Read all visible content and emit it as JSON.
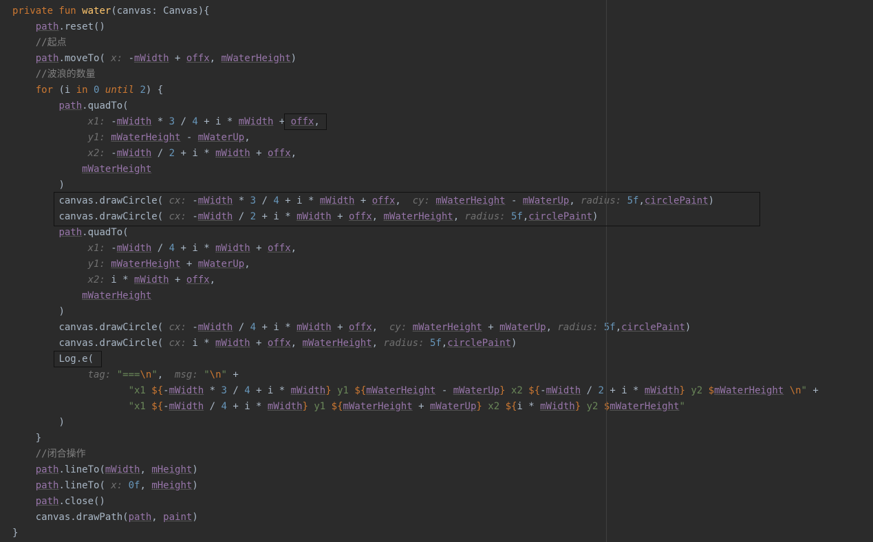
{
  "code": {
    "l1_pre": "private fun ",
    "l1_fn": "water",
    "l1_post": "(canvas: Canvas){",
    "l2a": "path",
    "l2b": ".reset()",
    "l3": "//起点",
    "l4a": "path",
    "l4b": ".moveTo( ",
    "l4c": "x: ",
    "l4d": "-",
    "l4e": "mWidth",
    "l4f": " + ",
    "l4g": "offx",
    "l4h": ", ",
    "l4i": "mWaterHeight",
    "l4j": ")",
    "l5": "//波浪的数量",
    "l6a": "for ",
    "l6b": "(i ",
    "l6c": "in ",
    "l6d": "0 ",
    "l6e": "until ",
    "l6f": "2",
    "l6g": ") {",
    "l7a": "path",
    "l7b": ".quadTo(",
    "l8a": "x1: ",
    "l8b": "-",
    "l8c": "mWidth",
    "l8d": " * ",
    "l8e": "3",
    "l8f": " / ",
    "l8g": "4",
    "l8h": " + i * ",
    "l8i": "mWidth",
    "l8j": " + ",
    "l8k": "offx",
    "l8l": ",",
    "l9a": "y1: ",
    "l9b": "mWaterHeight",
    "l9c": " - ",
    "l9d": "mWaterUp",
    "l9e": ",",
    "l10a": "x2: ",
    "l10b": "-",
    "l10c": "mWidth",
    "l10d": " / ",
    "l10e": "2",
    "l10f": " + i * ",
    "l10g": "mWidth",
    "l10h": " + ",
    "l10i": "offx",
    "l10j": ",",
    "l11a": "mWaterHeight",
    "l12": ")",
    "l13a": "canvas.drawCircle( ",
    "l13b": "cx: ",
    "l13c": "-",
    "l13d": "mWidth",
    "l13e": " * ",
    "l13f": "3",
    "l13g": " / ",
    "l13h": "4",
    "l13i": " + i * ",
    "l13j": "mWidth",
    "l13k": " + ",
    "l13l": "offx",
    "l13m": ",  ",
    "l13n": "cy: ",
    "l13o": "mWaterHeight",
    "l13p": " - ",
    "l13q": "mWaterUp",
    "l13r": ", ",
    "l13s": "radius: ",
    "l13t": "5f",
    "l13u": ",",
    "l13v": "circlePaint",
    "l13w": ")",
    "l14a": "canvas.drawCircle( ",
    "l14b": "cx: ",
    "l14c": "-",
    "l14d": "mWidth",
    "l14e": " / ",
    "l14f": "2",
    "l14g": " + i * ",
    "l14h": "mWidth",
    "l14i": " + ",
    "l14j": "offx",
    "l14k": ", ",
    "l14l": "mWaterHeight",
    "l14m": ", ",
    "l14n": "radius: ",
    "l14o": "5f",
    "l14p": ",",
    "l14q": "circlePaint",
    "l14r": ")",
    "l15a": "path",
    "l15b": ".quadTo(",
    "l16a": "x1: ",
    "l16b": "-",
    "l16c": "mWidth",
    "l16d": " / ",
    "l16e": "4",
    "l16f": " + i * ",
    "l16g": "mWidth",
    "l16h": " + ",
    "l16i": "offx",
    "l16j": ",",
    "l17a": "y1: ",
    "l17b": "mWaterHeight",
    "l17c": " + ",
    "l17d": "mWaterUp",
    "l17e": ",",
    "l18a": "x2: ",
    "l18b": "i * ",
    "l18c": "mWidth",
    "l18d": " + ",
    "l18e": "offx",
    "l18f": ",",
    "l19a": "mWaterHeight",
    "l20": ")",
    "l21a": "canvas.drawCircle( ",
    "l21b": "cx: ",
    "l21c": "-",
    "l21d": "mWidth",
    "l21e": " / ",
    "l21f": "4",
    "l21g": " + i * ",
    "l21h": "mWidth",
    "l21i": " + ",
    "l21j": "offx",
    "l21k": ",  ",
    "l21l": "cy: ",
    "l21m": "mWaterHeight",
    "l21n": " + ",
    "l21o": "mWaterUp",
    "l21p": ", ",
    "l21q": "radius: ",
    "l21r": "5f",
    "l21s": ",",
    "l21t": "circlePaint",
    "l21u": ")",
    "l22a": "canvas.drawCircle( ",
    "l22b": "cx: ",
    "l22c": "i * ",
    "l22d": "mWidth",
    "l22e": " + ",
    "l22f": "offx",
    "l22g": ", ",
    "l22h": "mWaterHeight",
    "l22i": ", ",
    "l22j": "radius: ",
    "l22k": "5f",
    "l22l": ",",
    "l22m": "circlePaint",
    "l22n": ")",
    "l23a": "Log",
    "l23b": ".e(",
    "l24a": "tag: ",
    "l24b": "\"===",
    "l24c": "\\n",
    "l24d": "\"",
    "l24e": ",  ",
    "l24f": "msg: ",
    "l24g": "\"",
    "l24h": "\\n",
    "l24i": "\"",
    "l24j": " +",
    "l25a": "\"x1 ",
    "l25b": "${",
    "l25c": "-",
    "l25d": "mWidth",
    "l25e": " * ",
    "l25f": "3",
    "l25g": " / ",
    "l25h": "4",
    "l25i": " + i * ",
    "l25j": "mWidth",
    "l25k": "}",
    "l25l": " y1 ",
    "l25m": "${",
    "l25n": "mWaterHeight",
    "l25o": " - ",
    "l25p": "mWaterUp",
    "l25q": "}",
    "l25r": " x2 ",
    "l25s": "${",
    "l25t": "-",
    "l25u": "mWidth",
    "l25v": " / ",
    "l25w": "2",
    "l25x": " + i * ",
    "l25y": "mWidth",
    "l25z": "}",
    "l25aa": " y2 ",
    "l25ab": "$",
    "l25ac": "mWaterHeight",
    "l25ad": " ",
    "l25ae": "\\n",
    "l25af": "\"",
    "l25ag": " +",
    "l26a": "\"x1 ",
    "l26b": "${",
    "l26c": "-",
    "l26d": "mWidth",
    "l26e": " / ",
    "l26f": "4",
    "l26g": " + i * ",
    "l26h": "mWidth",
    "l26i": "}",
    "l26j": " y1 ",
    "l26k": "${",
    "l26l": "mWaterHeight",
    "l26m": " + ",
    "l26n": "mWaterUp",
    "l26o": "}",
    "l26p": " x2 ",
    "l26q": "${",
    "l26r": "i * ",
    "l26s": "mWidth",
    "l26t": "}",
    "l26u": " y2 ",
    "l26v": "$",
    "l26w": "mWaterHeight",
    "l26x": "\"",
    "l27": ")",
    "l28": "}",
    "l29": "//闭合操作",
    "l30a": "path",
    "l30b": ".lineTo(",
    "l30c": "mWidth",
    "l30d": ", ",
    "l30e": "mHeight",
    "l30f": ")",
    "l31a": "path",
    "l31b": ".lineTo( ",
    "l31c": "x: ",
    "l31d": "0f",
    "l31e": ", ",
    "l31f": "mHeight",
    "l31g": ")",
    "l32a": "path",
    "l32b": ".close()",
    "l33a": "canvas.drawPath(",
    "l33b": "path",
    "l33c": ", ",
    "l33d": "paint",
    "l33e": ")",
    "l34": "}"
  }
}
